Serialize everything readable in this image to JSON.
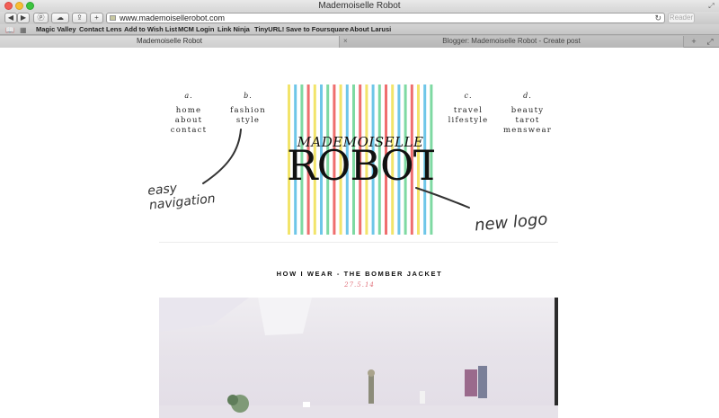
{
  "window": {
    "title": "Mademoiselle Robot"
  },
  "toolbar": {
    "url": "www.mademoisellerobot.com",
    "reader_label": "Reader",
    "back_icon": "back-arrow-icon",
    "forward_icon": "forward-arrow-icon"
  },
  "bookmarks": [
    "Magic Valley",
    "Contact Lens",
    "Add to Wish List",
    "MCM Login",
    "Link Ninja",
    "TinyURL!",
    "Save to Foursquare",
    "About Larusi"
  ],
  "tabs": [
    {
      "label": "Mademoiselle Robot",
      "active": true
    },
    {
      "label": "Blogger: Mademoiselle Robot - Create post",
      "active": false
    }
  ],
  "nav": {
    "a": {
      "letter": "a.",
      "links": [
        "home",
        "about",
        "contact"
      ]
    },
    "b": {
      "letter": "b.",
      "links": [
        "fashion",
        "style"
      ]
    },
    "c": {
      "letter": "c.",
      "links": [
        "travel",
        "lifestyle"
      ]
    },
    "d": {
      "letter": "d.",
      "links": [
        "beauty",
        "tarot",
        "menswear"
      ]
    }
  },
  "logo": {
    "top": "MADEMOISELLE",
    "bottom": "ROBOT",
    "stripe_colors": [
      "#f2e46a",
      "#6ec6e8",
      "#7ed9a2",
      "#ef6e6e"
    ]
  },
  "annotations": {
    "nav_line1": "easy",
    "nav_line2": "navigation",
    "logo": "new logo"
  },
  "post": {
    "title": "HOW I WEAR - THE BOMBER JACKET",
    "date": "27.5.14"
  }
}
